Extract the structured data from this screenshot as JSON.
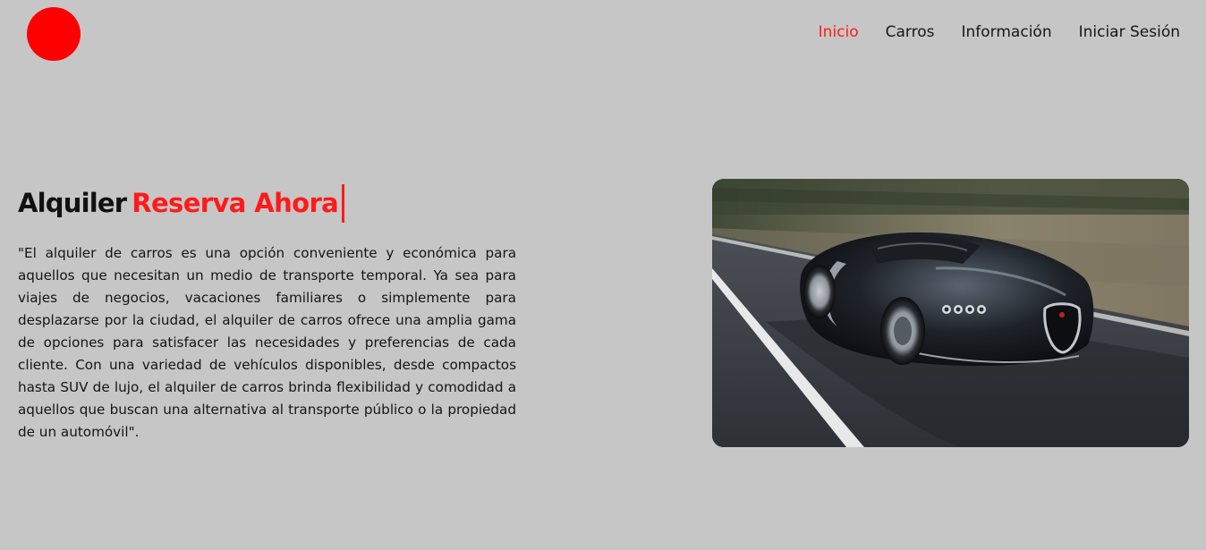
{
  "brand": {
    "logo_color": "#ff0000"
  },
  "nav": {
    "items": [
      {
        "label": "Inicio",
        "active": true
      },
      {
        "label": "Carros",
        "active": false
      },
      {
        "label": "Información",
        "active": false
      },
      {
        "label": "Iniciar Sesión",
        "active": false
      }
    ],
    "active_color": "#ff1a1a"
  },
  "hero": {
    "title_static": "Alquiler",
    "title_typed": "Reserva Ahora",
    "description": "\"El alquiler de carros es una opción conveniente y económica para aquellos que necesitan un medio de transporte temporal. Ya sea para viajes de negocios, vacaciones familiares o simplemente para desplazarse por la ciudad, el alquiler de carros ofrece una amplia gama de opciones para satisfacer las necesidades y preferencias de cada cliente. Con una variedad de vehículos disponibles, desde compactos hasta SUV de lujo, el alquiler de carros brinda flexibilidad y comodidad a aquellos que buscan una alternativa al transporte público o la propiedad de un automóvil\".",
    "image_icon": "sports-car-photo"
  },
  "colors": {
    "background": "#c6c6c6",
    "accent": "#ff1a1a"
  }
}
